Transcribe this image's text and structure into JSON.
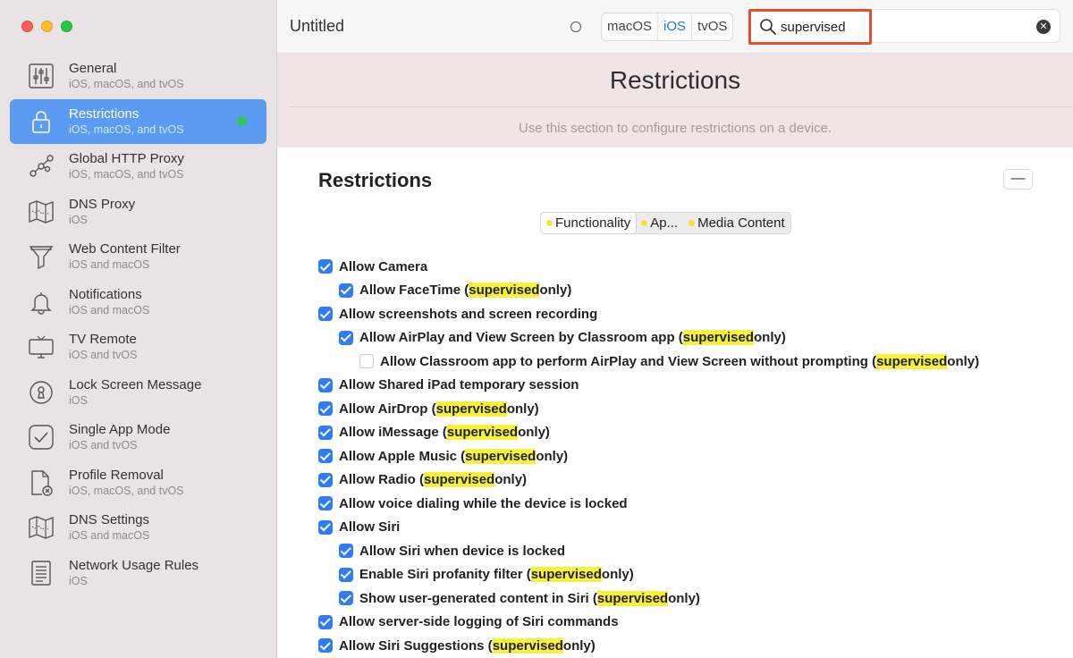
{
  "window": {
    "title": "Untitled"
  },
  "toolbar": {
    "platforms": [
      {
        "label": "macOS",
        "selected": false
      },
      {
        "label": "iOS",
        "selected": true
      },
      {
        "label": "tvOS",
        "selected": false
      }
    ],
    "search": {
      "value": "supervised"
    }
  },
  "sidebar": {
    "items": [
      {
        "title": "General",
        "subtitle": "iOS, macOS, and tvOS",
        "icon": "sliders-icon",
        "active": false
      },
      {
        "title": "Restrictions",
        "subtitle": "iOS, macOS, and tvOS",
        "icon": "lock-icon",
        "active": true
      },
      {
        "title": "Global HTTP Proxy",
        "subtitle": "iOS, macOS, and tvOS",
        "icon": "proxy-nodes-icon",
        "active": false
      },
      {
        "title": "DNS Proxy",
        "subtitle": "iOS",
        "icon": "map-icon",
        "active": false
      },
      {
        "title": "Web Content Filter",
        "subtitle": "iOS and macOS",
        "icon": "funnel-icon",
        "active": false
      },
      {
        "title": "Notifications",
        "subtitle": "iOS and macOS",
        "icon": "bell-icon",
        "active": false
      },
      {
        "title": "TV Remote",
        "subtitle": "iOS and tvOS",
        "icon": "tv-icon",
        "active": false
      },
      {
        "title": "Lock Screen Message",
        "subtitle": "iOS",
        "icon": "keyhole-icon",
        "active": false
      },
      {
        "title": "Single App Mode",
        "subtitle": "iOS and tvOS",
        "icon": "checkmark-square-icon",
        "active": false
      },
      {
        "title": "Profile Removal",
        "subtitle": "iOS, macOS, and tvOS",
        "icon": "document-remove-icon",
        "active": false
      },
      {
        "title": "DNS Settings",
        "subtitle": "iOS and macOS",
        "icon": "map-icon",
        "active": false
      },
      {
        "title": "Network Usage Rules",
        "subtitle": "iOS",
        "icon": "list-document-icon",
        "active": false
      }
    ]
  },
  "banner": {
    "title": "Restrictions",
    "subtitle": "Use this section to configure restrictions on a device."
  },
  "section": {
    "title": "Restrictions",
    "collapse_label": "—",
    "tabs": [
      {
        "label": "Functionality",
        "selected": true
      },
      {
        "label": "Ap...",
        "selected": false
      },
      {
        "label": "Media Content",
        "selected": false
      }
    ],
    "options": [
      {
        "level": 0,
        "checked": true,
        "text": "Allow Camera",
        "hl": "",
        "suffix": ""
      },
      {
        "level": 1,
        "checked": true,
        "text": "Allow FaceTime (",
        "hl": "supervised",
        "suffix": " only)"
      },
      {
        "level": 0,
        "checked": true,
        "text": "Allow screenshots and screen recording",
        "hl": "",
        "suffix": ""
      },
      {
        "level": 1,
        "checked": true,
        "text": "Allow AirPlay and View Screen by Classroom app (",
        "hl": "supervised",
        "suffix": " only)"
      },
      {
        "level": 2,
        "checked": false,
        "text": "Allow Classroom app to perform AirPlay and View Screen without prompting (",
        "hl": "supervised",
        "suffix": " only)"
      },
      {
        "level": 0,
        "checked": true,
        "text": "Allow Shared iPad temporary session",
        "hl": "",
        "suffix": ""
      },
      {
        "level": 0,
        "checked": true,
        "text": "Allow AirDrop (",
        "hl": "supervised",
        "suffix": " only)"
      },
      {
        "level": 0,
        "checked": true,
        "text": "Allow iMessage (",
        "hl": "supervised",
        "suffix": " only)"
      },
      {
        "level": 0,
        "checked": true,
        "text": "Allow Apple Music (",
        "hl": "supervised",
        "suffix": " only)"
      },
      {
        "level": 0,
        "checked": true,
        "text": "Allow Radio (",
        "hl": "supervised",
        "suffix": " only)"
      },
      {
        "level": 0,
        "checked": true,
        "text": "Allow voice dialing while the device is locked",
        "hl": "",
        "suffix": ""
      },
      {
        "level": 0,
        "checked": true,
        "text": "Allow Siri",
        "hl": "",
        "suffix": ""
      },
      {
        "level": 1,
        "checked": true,
        "text": "Allow Siri when device is locked",
        "hl": "",
        "suffix": ""
      },
      {
        "level": 1,
        "checked": true,
        "text": "Enable Siri profanity filter (",
        "hl": "supervised",
        "suffix": " only)"
      },
      {
        "level": 1,
        "checked": true,
        "text": "Show user-generated content in Siri (",
        "hl": "supervised",
        "suffix": " only)"
      },
      {
        "level": 0,
        "checked": true,
        "text": "Allow server-side logging of Siri commands",
        "hl": "",
        "suffix": ""
      },
      {
        "level": 0,
        "checked": true,
        "text": "Allow Siri Suggestions (",
        "hl": "supervised",
        "suffix": " only)"
      }
    ]
  },
  "colors": {
    "accent": "#2f7cf6",
    "sidebar_active": "#5b9cf2",
    "highlight": "#f7f03c",
    "search_outline": "#e0502e"
  }
}
